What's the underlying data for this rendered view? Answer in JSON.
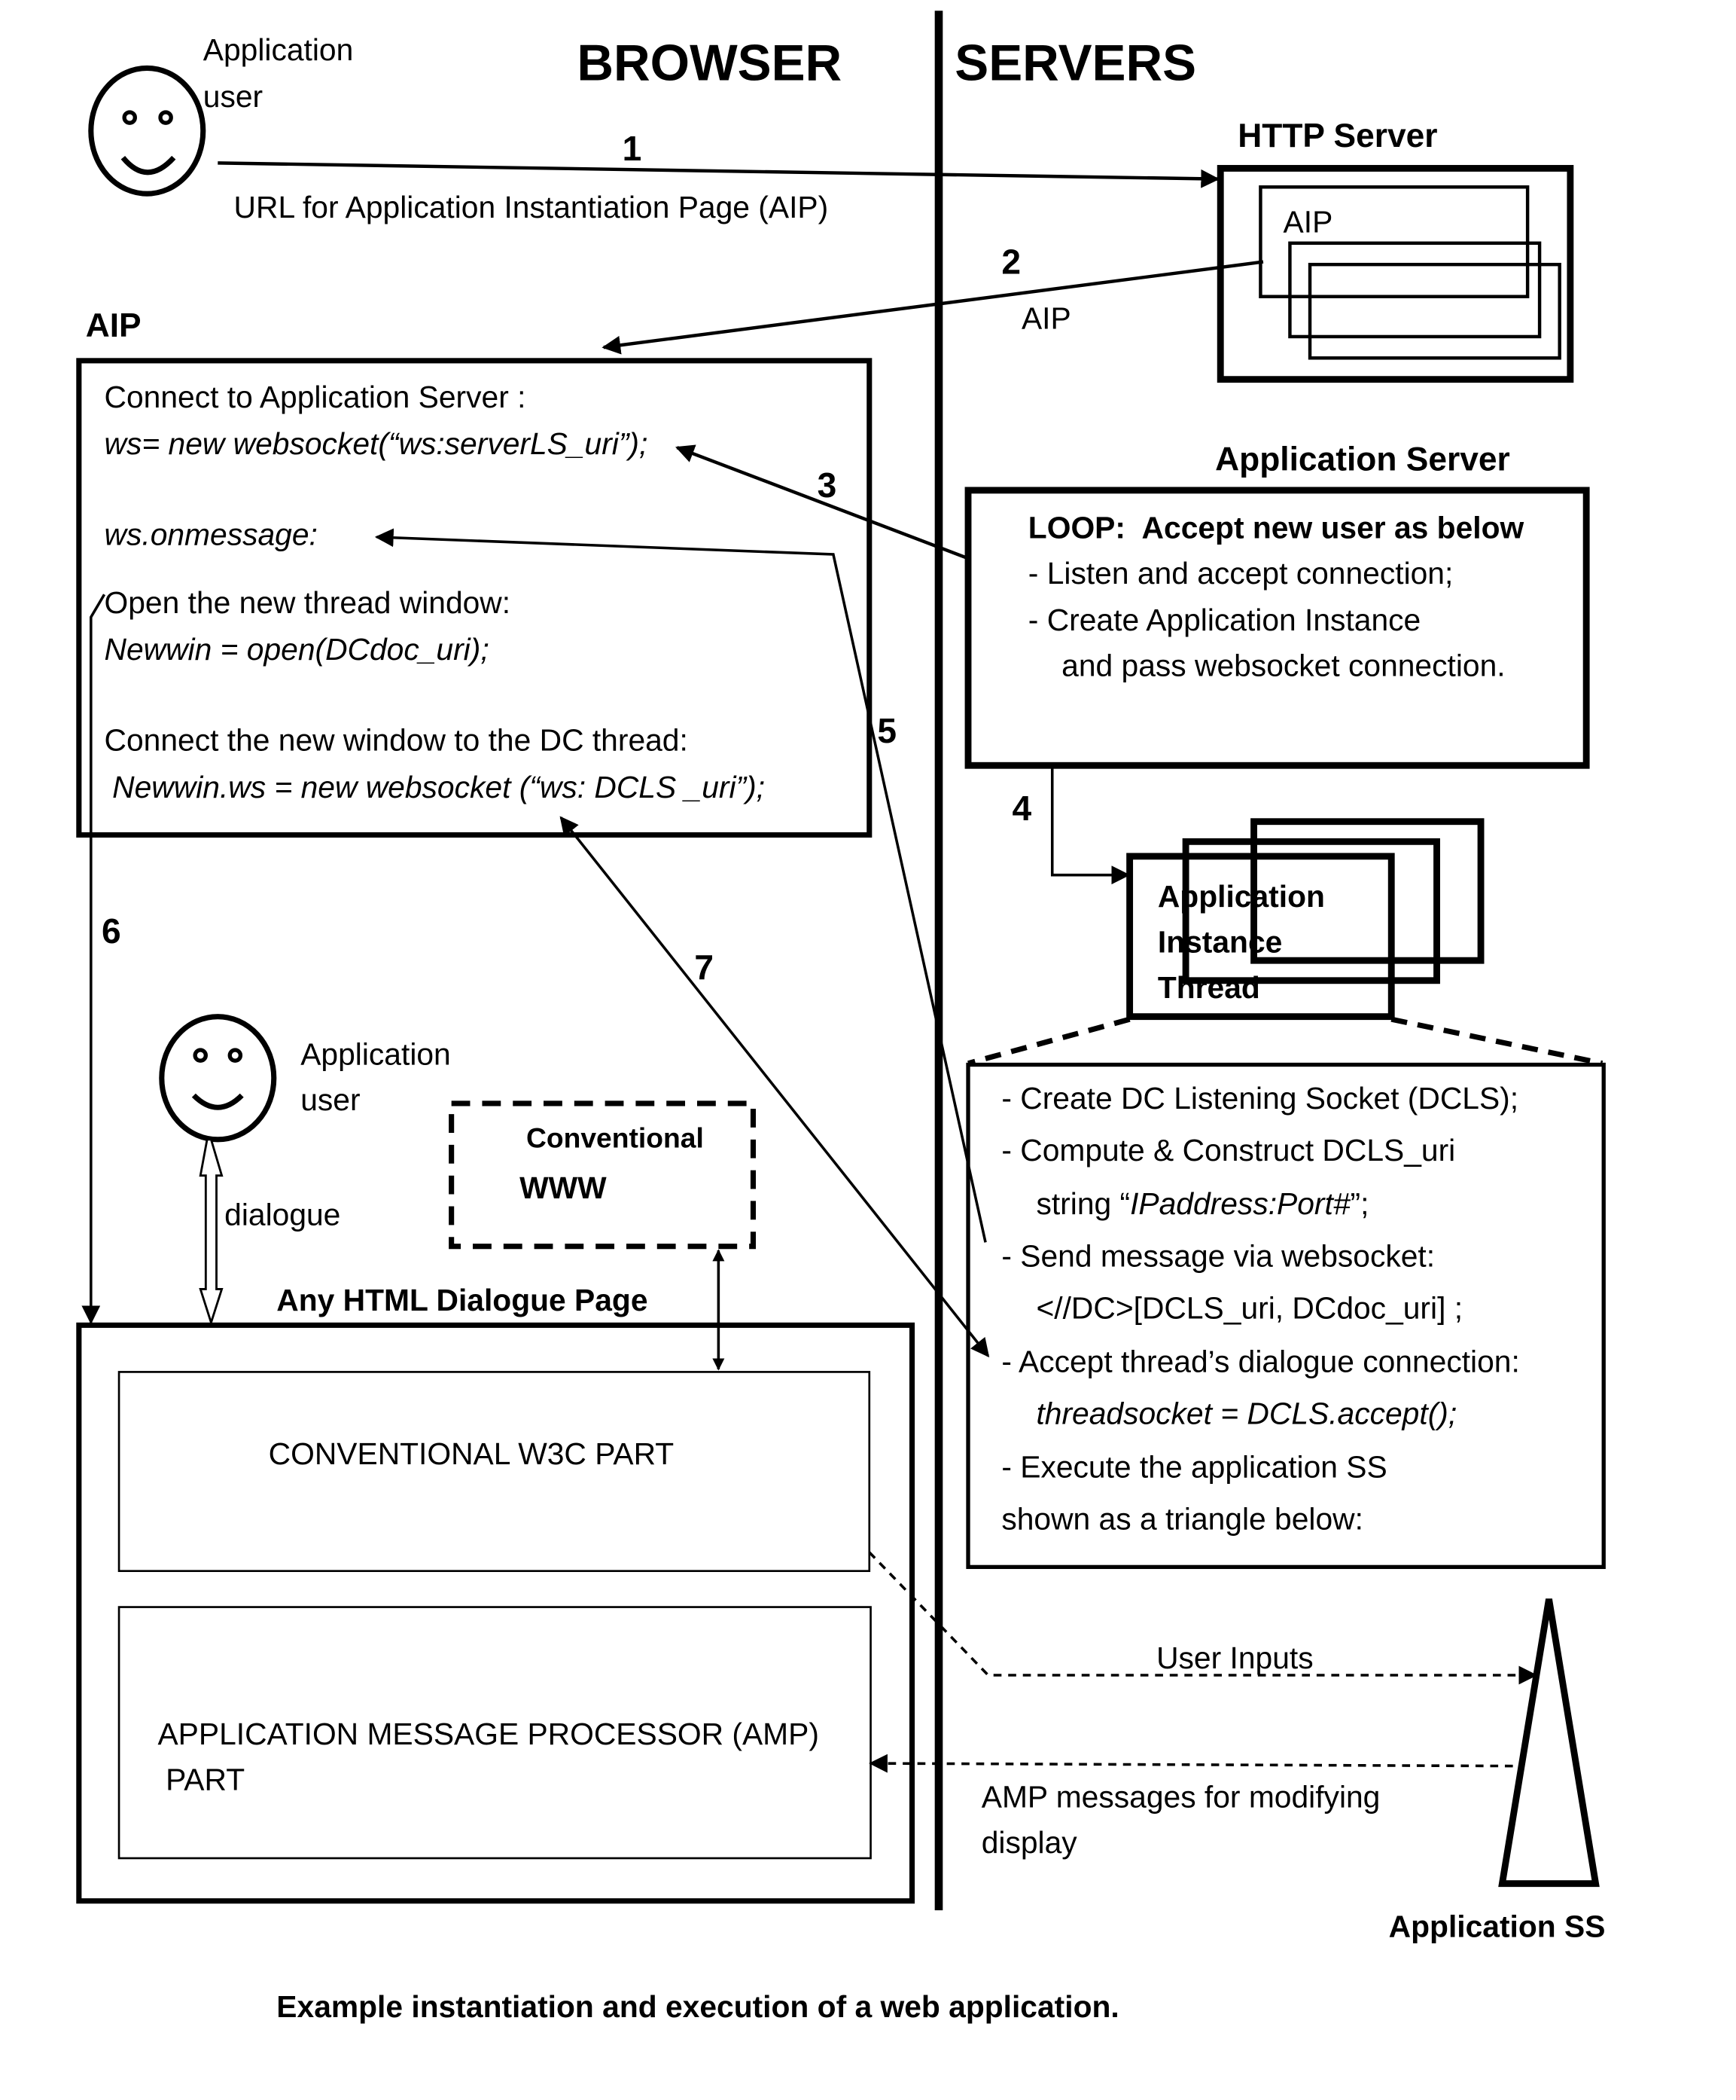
{
  "headers": {
    "browser": "BROWSER",
    "servers": "SERVERS"
  },
  "top_user": {
    "label_line1": "Application",
    "label_line2": "user"
  },
  "step1": {
    "number": "1",
    "label": "URL for Application Instantiation  Page (AIP)"
  },
  "http_server": {
    "title": "HTTP Server",
    "page_label": "AIP"
  },
  "step2": {
    "number": "2",
    "label": "AIP"
  },
  "aip_box": {
    "title": "AIP",
    "lines": [
      "Connect to Application Server :",
      "ws= new websocket(“ws:serverLS_uri”);",
      "ws.onmessage:",
      "Open the new thread window:",
      "Newwin = open(DCdoc_uri);",
      "Connect the new window to the DC thread:",
      "Newwin.ws = new websocket (“ws: DCLS _uri”);"
    ]
  },
  "app_server": {
    "title": "Application Server",
    "loop_label": "LOOP:",
    "loop_text": "Accept new user as below",
    "lines": [
      "-  Listen and accept connection;",
      "- Create Application Instance",
      "and pass websocket connection."
    ]
  },
  "step3": {
    "number": "3"
  },
  "step4": {
    "number": "4"
  },
  "step5": {
    "number": "5"
  },
  "step6": {
    "number": "6"
  },
  "step7": {
    "number": "7"
  },
  "instance_thread": {
    "line1": "Application",
    "line2": "Instance",
    "line3": "Thread"
  },
  "thread_detail": {
    "lines": [
      "-  Create DC Listening Socket (DCLS);",
      "-  Compute & Construct DCLS_uri",
      "string “",
      "IPaddress:Port#",
      "”;",
      "-  Send message via websocket:",
      "<//DC>[DCLS_uri,  DCdoc_uri] ;",
      "- Accept thread’s dialogue connection:",
      "threadsocket = DCLS.accept();",
      "-  Execute the application SS",
      "shown as a triangle below:"
    ]
  },
  "second_user": {
    "label_line1": "Application",
    "label_line2": "user",
    "dialogue": "dialogue"
  },
  "conventional_www": {
    "line1": "Conventional",
    "line2": "WWW"
  },
  "dialogue_page": {
    "title": "Any HTML Dialogue Page",
    "w3c_part": "CONVENTIONAL W3C PART",
    "amp_part_line1": "APPLICATION MESSAGE PROCESSOR (AMP)",
    "amp_part_line2": "PART"
  },
  "flows": {
    "user_inputs": "User Inputs",
    "amp_messages_line1": "AMP messages for modifying",
    "amp_messages_line2": "display"
  },
  "app_ss": {
    "label": "Application SS"
  },
  "caption": "Example  instantiation and execution of a web application."
}
